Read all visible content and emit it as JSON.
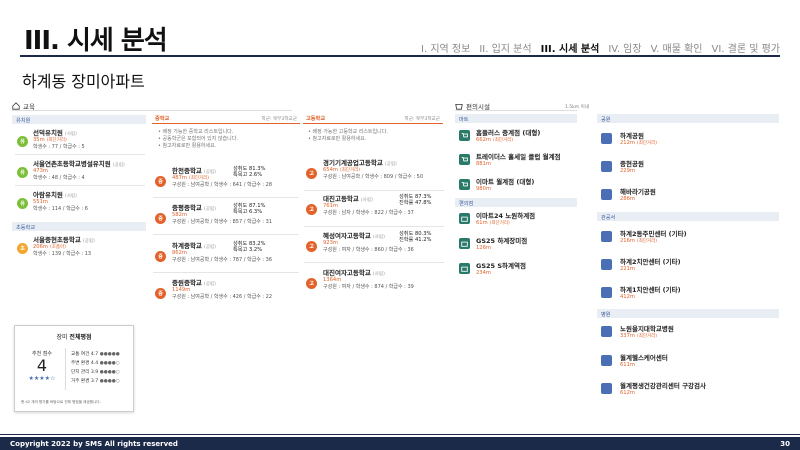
{
  "header": {
    "title": "III. 시세 분석",
    "nav": [
      "I. 지역 정보",
      "II. 입지 분석",
      "III. 시세 분석",
      "IV. 임장",
      "V. 매물 확인",
      "VI. 결론 및 평가"
    ],
    "active_index": 2
  },
  "subtitle": "하계동 장미아파트",
  "education": {
    "title": "교육",
    "kindergarten_label": "유치원",
    "kindergartens": [
      {
        "icon": "유",
        "name": "선덕유치원",
        "tag": "(사립)",
        "distance": "35m",
        "note": "(최단거리)",
        "info": "학생수 : 77 / 학급수 : 5"
      },
      {
        "icon": "유",
        "name": "서울연촌초등학교병설유치원",
        "tag": "(공립)",
        "distance": "473m",
        "note": "",
        "info": "학생수 : 48 / 학급수 : 4"
      },
      {
        "icon": "유",
        "name": "아람유치원",
        "tag": "(사립)",
        "distance": "551m",
        "note": "",
        "info": "학생수 : 114 / 학급수 : 6"
      }
    ],
    "elementary_label": "초등학교",
    "elementary": [
      {
        "icon": "초",
        "name": "서울중현초등학교",
        "tag": "(공립)",
        "distance": "206m",
        "note": "(초품아)",
        "info": "학생수 : 139 / 학급수 : 13"
      }
    ],
    "middle": {
      "header": "중학교",
      "header_right": "학군: 북부3학교군",
      "notes": [
        "배정 가능한 중학교 리스트입니다.",
        "공동학군은 포함되어 있지 않습니다.",
        "참고자료로만 활용하세요."
      ],
      "items": [
        {
          "icon": "중",
          "name": "한천중학교",
          "tag": "(공립)",
          "distance": "487m",
          "note": "(최단거리)",
          "rate1": "성취도 81.3%",
          "rate2": "특목고 2.6%",
          "info": "구성원 : 남여공학 / 학생수 : 641 / 학급수 : 28"
        },
        {
          "icon": "중",
          "name": "중평중학교",
          "tag": "(공립)",
          "distance": "582m",
          "note": "",
          "rate1": "성취도 87.1%",
          "rate2": "특목고 6.3%",
          "info": "구성원 : 남여공학 / 학생수 : 857 / 학급수 : 31"
        },
        {
          "icon": "중",
          "name": "하계중학교",
          "tag": "(공립)",
          "distance": "862m",
          "note": "",
          "rate1": "성취도 83.2%",
          "rate2": "특목고 3.2%",
          "info": "구성원 : 남여공학 / 학생수 : 787 / 학급수 : 36"
        },
        {
          "icon": "중",
          "name": "중원중학교",
          "tag": "(공립)",
          "distance": "1149m",
          "note": "",
          "rate1": "",
          "rate2": "",
          "info": "구성원 : 남여공학 / 학생수 : 426 / 학급수 : 22"
        }
      ]
    },
    "high": {
      "header": "고등학교",
      "header_right": "학군: 북부3학교군",
      "notes": [
        "배정 가능한 고등학교 리스트입니다.",
        "참고자료로만 활용하세요."
      ],
      "items": [
        {
          "icon": "고",
          "name": "경기기계공업고등학교",
          "tag": "(공립)",
          "distance": "654m",
          "note": "(최단거리)",
          "rate1": "",
          "rate2": "",
          "info": "구성원 : 남여공학 / 학생수 : 809 / 학급수 : 50"
        },
        {
          "icon": "고",
          "name": "대진고등학교",
          "tag": "(사립)",
          "distance": "761m",
          "note": "",
          "rate1": "성취도 87.3%",
          "rate2": "진학률 47.8%",
          "info": "구성원 : 남자 / 학생수 : 822 / 학급수 : 37"
        },
        {
          "icon": "고",
          "name": "혜성여자고등학교",
          "tag": "(사립)",
          "distance": "923m",
          "note": "",
          "rate1": "성취도 80.3%",
          "rate2": "진학률 41.2%",
          "info": "구성원 : 여자 / 학생수 : 860 / 학급수 : 36"
        },
        {
          "icon": "고",
          "name": "대진여자고등학교",
          "tag": "(사립)",
          "distance": "1364m",
          "note": "",
          "rate1": "",
          "rate2": "",
          "info": "구성원 : 여자 / 학생수 : 874 / 학급수 : 39"
        }
      ]
    }
  },
  "convenience": {
    "title": "편의시설",
    "range": "1.5km 이내",
    "mart_label": "마트",
    "marts": [
      {
        "name": "홈플러스 중계점 (대형)",
        "distance": "662m",
        "note": "(최단거리)"
      },
      {
        "name": "트레이더스 홀세일 클럽 월계점",
        "distance": "881m",
        "note": ""
      },
      {
        "name": "이마트 월계점 (대형)",
        "distance": "980m",
        "note": ""
      }
    ],
    "store_label": "편의점",
    "stores": [
      {
        "name": "이마트24 노원하계점",
        "distance": "61m",
        "note": "(최단거리)"
      },
      {
        "name": "GS25 하계장미점",
        "distance": "126m",
        "note": ""
      },
      {
        "name": "GS25 S하계역점",
        "distance": "234m",
        "note": ""
      }
    ]
  },
  "facilities": {
    "park_label": "공원",
    "parks": [
      {
        "name": "하계공원",
        "distance": "212m",
        "note": "(최단거리)"
      },
      {
        "name": "중현공원",
        "distance": "229m",
        "note": ""
      },
      {
        "name": "해바라기공원",
        "distance": "286m",
        "note": ""
      }
    ],
    "office_label": "관공서",
    "offices": [
      {
        "name": "하계2동주민센터 (기타)",
        "distance": "216m",
        "note": "(최단거리)"
      },
      {
        "name": "하계2치안센터 (기타)",
        "distance": "221m",
        "note": ""
      },
      {
        "name": "하계1치안센터 (기타)",
        "distance": "412m",
        "note": ""
      }
    ],
    "hospital_label": "병원",
    "hospitals": [
      {
        "name": "노원을지대학교병원",
        "distance": "337m",
        "note": "(최단거리)"
      },
      {
        "name": "월계헬스케어센터",
        "distance": "611m",
        "note": ""
      },
      {
        "name": "월계평생건강관리센터 구강검사",
        "distance": "612m",
        "note": ""
      }
    ]
  },
  "rating": {
    "title_a": "장미 ",
    "title_b": "전체평점",
    "score_label": "추천 점수",
    "score": "4",
    "stars": 4,
    "items": [
      {
        "label": "교통 여건",
        "value": "4.7",
        "stars": 5
      },
      {
        "label": "주변 환경",
        "value": "4.4",
        "stars": 4
      },
      {
        "label": "단지 관리",
        "value": "3.9",
        "stars": 4
      },
      {
        "label": "거주 환경",
        "value": "3.7",
        "stars": 4
      }
    ],
    "footnote": "총 42 개의 평가를 바탕으로 전체 평점을 제공합니다."
  },
  "footer": {
    "copyright": "Copyright 2022 by SMS All rights reserved",
    "page": "30"
  },
  "colors": {
    "orange": "#e2622a",
    "green": "#7cbf3a",
    "teal": "#2a7a6a",
    "blue": "#4a6fb5",
    "navy": "#1c2a4a",
    "elem": "#f2a830"
  }
}
